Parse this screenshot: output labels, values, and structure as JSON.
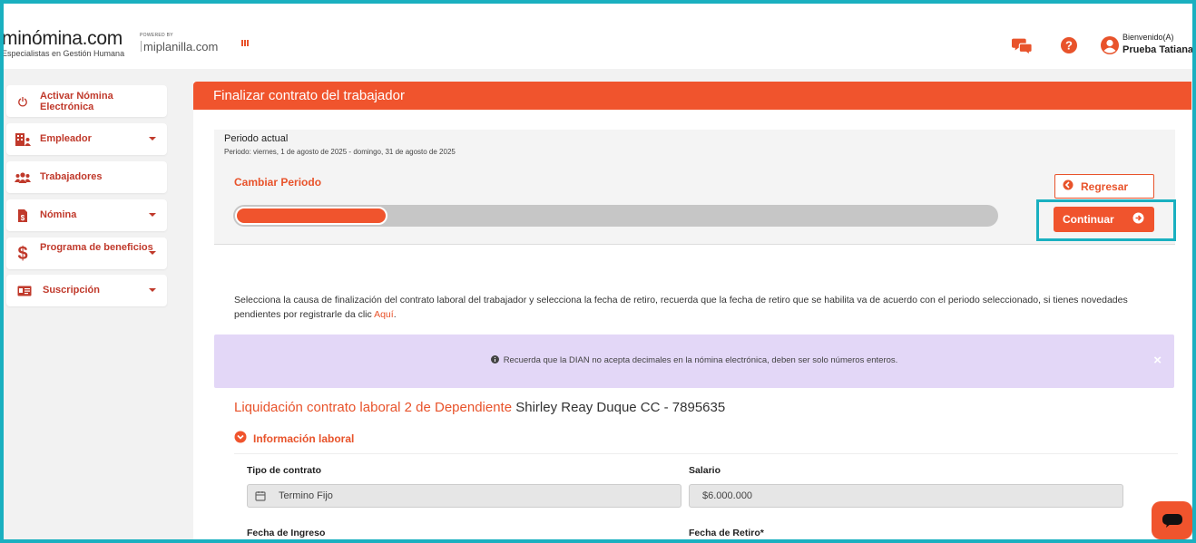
{
  "header": {
    "logo_main": "minómina.com",
    "logo_sub": "Especialistas en Gestión Humana",
    "powered_by": "POWERED BY",
    "partner": "miplanilla.com",
    "welcome": "Bienvenido(A)",
    "user_name": "Prueba Tatiana"
  },
  "sidebar": {
    "items": [
      {
        "label": "Activar Nómina Electrónica",
        "icon": "power-icon"
      },
      {
        "label": "Empleador",
        "icon": "building-icon"
      },
      {
        "label": "Trabajadores",
        "icon": "users-icon"
      },
      {
        "label": "Nómina",
        "icon": "invoice-icon"
      },
      {
        "label": "Programa de beneficios",
        "icon": "dollar-icon"
      },
      {
        "label": "Suscripción",
        "icon": "id-card-icon"
      }
    ]
  },
  "main": {
    "title": "Finalizar contrato del trabajador",
    "period_title": "Periodo actual",
    "period_range": "Periodo: viernes, 1 de agosto de 2025 - domingo, 31 de agosto de 2025",
    "change_period": "Cambiar Periodo",
    "progress_fraction": 0.2,
    "back_label": "Regresar",
    "continue_label": "Continuar",
    "instructions": "Selecciona la causa de finalización del contrato laboral del trabajador y selecciona la fecha de retiro, recuerda que la fecha de retiro que se habilita va de acuerdo con el periodo seleccionado, si tienes novedades pendientes por registrarle da clic ",
    "instructions_link": "Aquí",
    "instructions_end": ".",
    "alert_text": "Recuerda que la DIAN no acepta decimales en la nómina electrónica, deben ser solo números enteros.",
    "alert_close": "×",
    "liq_title": "Liquidación contrato laboral 2 de Dependiente",
    "liq_worker": "Shirley Reay Duque CC - 7895635",
    "section_title": "Información laboral",
    "fields": {
      "contract_type_label": "Tipo de contrato",
      "contract_type_value": "Termino Fijo",
      "salary_label": "Salario",
      "salary_value": "$6.000.000",
      "start_date_label": "Fecha de Ingreso",
      "end_date_label": "Fecha de Retiro*"
    }
  },
  "colors": {
    "accent": "#f0542d",
    "sidebar_text": "#c0392b",
    "highlight": "#1ab0c0",
    "alert_bg": "#e3d7f7"
  }
}
